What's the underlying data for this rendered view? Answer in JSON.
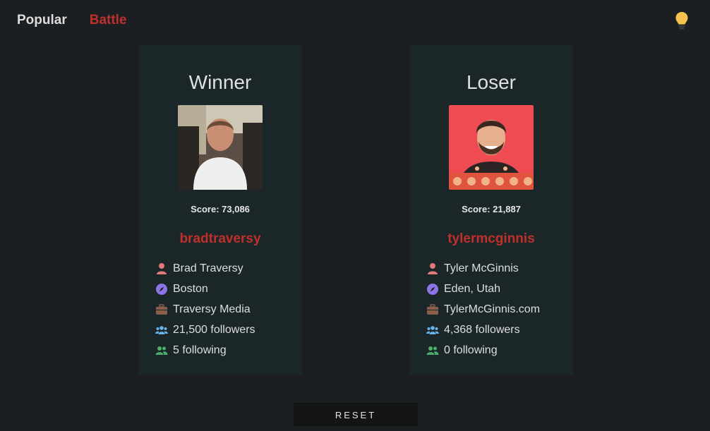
{
  "nav": {
    "popular": "Popular",
    "battle": "Battle"
  },
  "theme_toggle": {
    "icon": "lightbulb-icon",
    "color": "#f5c34c"
  },
  "colors": {
    "background": "#1c1f22",
    "card": "#1b2628",
    "accent": "#c0302a",
    "user_icon": "#e07a7a",
    "compass_icon": "#8f74e8",
    "briefcase_icon": "#8a5e4a",
    "followers_icon": "#67b5e8",
    "following_icon": "#4caf6a"
  },
  "players": [
    {
      "header": "Winner",
      "score": "Score: 73,086",
      "username": "bradtraversy",
      "name": "Brad Traversy",
      "location": "Boston",
      "company": "Traversy Media",
      "followers": "21,500 followers",
      "following": "5 following"
    },
    {
      "header": "Loser",
      "score": "Score: 21,887",
      "username": "tylermcginnis",
      "name": "Tyler McGinnis",
      "location": "Eden, Utah",
      "company": "TylerMcGinnis.com",
      "followers": "4,368 followers",
      "following": "0 following"
    }
  ],
  "reset_label": "RESET"
}
